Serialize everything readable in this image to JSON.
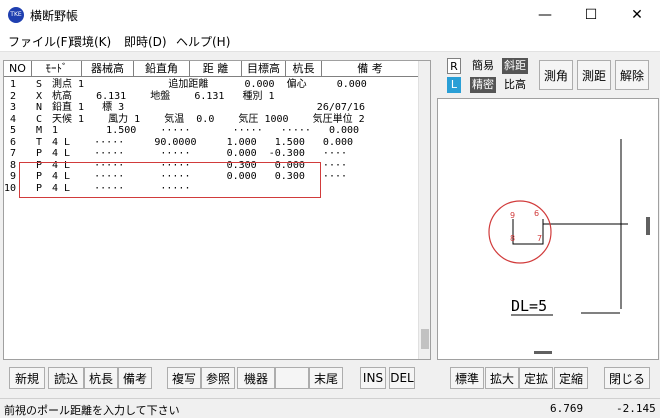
{
  "window": {
    "title": "横断野帳",
    "icon_text": "TKE",
    "minimize_glyph": "—",
    "maximize_glyph": "☐",
    "close_glyph": "✕"
  },
  "menu": [
    {
      "label": "ファイル(F)"
    },
    {
      "label": "環境(K)"
    },
    {
      "label": "即時(D)"
    },
    {
      "label": "ヘルプ(H)"
    }
  ],
  "table": {
    "headers": [
      "NO",
      "ﾓｰﾄﾞ",
      "器械高",
      "鉛直角",
      "距  離",
      "目標高",
      "杭長",
      "備    考"
    ],
    "rows": [
      {
        "no": "1",
        "mode": "S",
        "text": "測点 1              追加距離      0.000  偏心     0.000"
      },
      {
        "no": "2",
        "mode": "X",
        "text": "杭高    6.131    地盤    6.131   種別 1"
      },
      {
        "no": "3",
        "mode": "N",
        "text": "鉛直 1   標 3                                26/07/16"
      },
      {
        "no": "4",
        "mode": "C",
        "text": "天候 1    風力 1    気温  0.0    気圧 1000    気圧単位 2"
      },
      {
        "no": "5",
        "mode": "M",
        "text": "1        1.500    ·····       ·····   ·····   0.000"
      },
      {
        "no": "6",
        "mode": "T",
        "text": "4 L    ·····     90.0000     1.000   1.500   0.000"
      },
      {
        "no": "7",
        "mode": "P",
        "text": "4 L    ·····      ·····      0.000  -0.300   ····"
      },
      {
        "no": "8",
        "mode": "P",
        "text": "4 L    ·····      ·····      0.300   0.000   ····"
      },
      {
        "no": "9",
        "mode": "P",
        "text": "4 L    ·····      ·····      0.000   0.300   ····"
      },
      {
        "no": "10",
        "mode": "P",
        "text": "4 L    ·····      ·····"
      }
    ]
  },
  "right_panel": {
    "tags": {
      "r": "R",
      "l": "L",
      "simple": "簡易",
      "precise": "精密",
      "slope": "斜距",
      "ratio": "比高"
    },
    "buttons": {
      "angle": "測角",
      "distance": "測距",
      "release": "解除"
    }
  },
  "cad": {
    "labels": {
      "p9": "9",
      "p6": "6",
      "p8": "8",
      "p7": "7"
    },
    "dl_text": "DL=5",
    "accent_color": "#d13b3b"
  },
  "bottom_buttons": {
    "new": "新規",
    "read": "読込",
    "pile_length": "杭長",
    "remarks": "備考",
    "copy": "複写",
    "reference": "参照",
    "instrument": "機器",
    "blank": "",
    "end": "末尾",
    "ins": "INS",
    "del": "DEL",
    "standard": "標準",
    "zoom_in": "拡大",
    "fixed_zoom": "定拡",
    "fixed_shrink": "定縮",
    "close": "閉じる"
  },
  "status": {
    "message": "前視のポール距離を入力して下さい",
    "x": "6.769",
    "y": "-2.145"
  }
}
